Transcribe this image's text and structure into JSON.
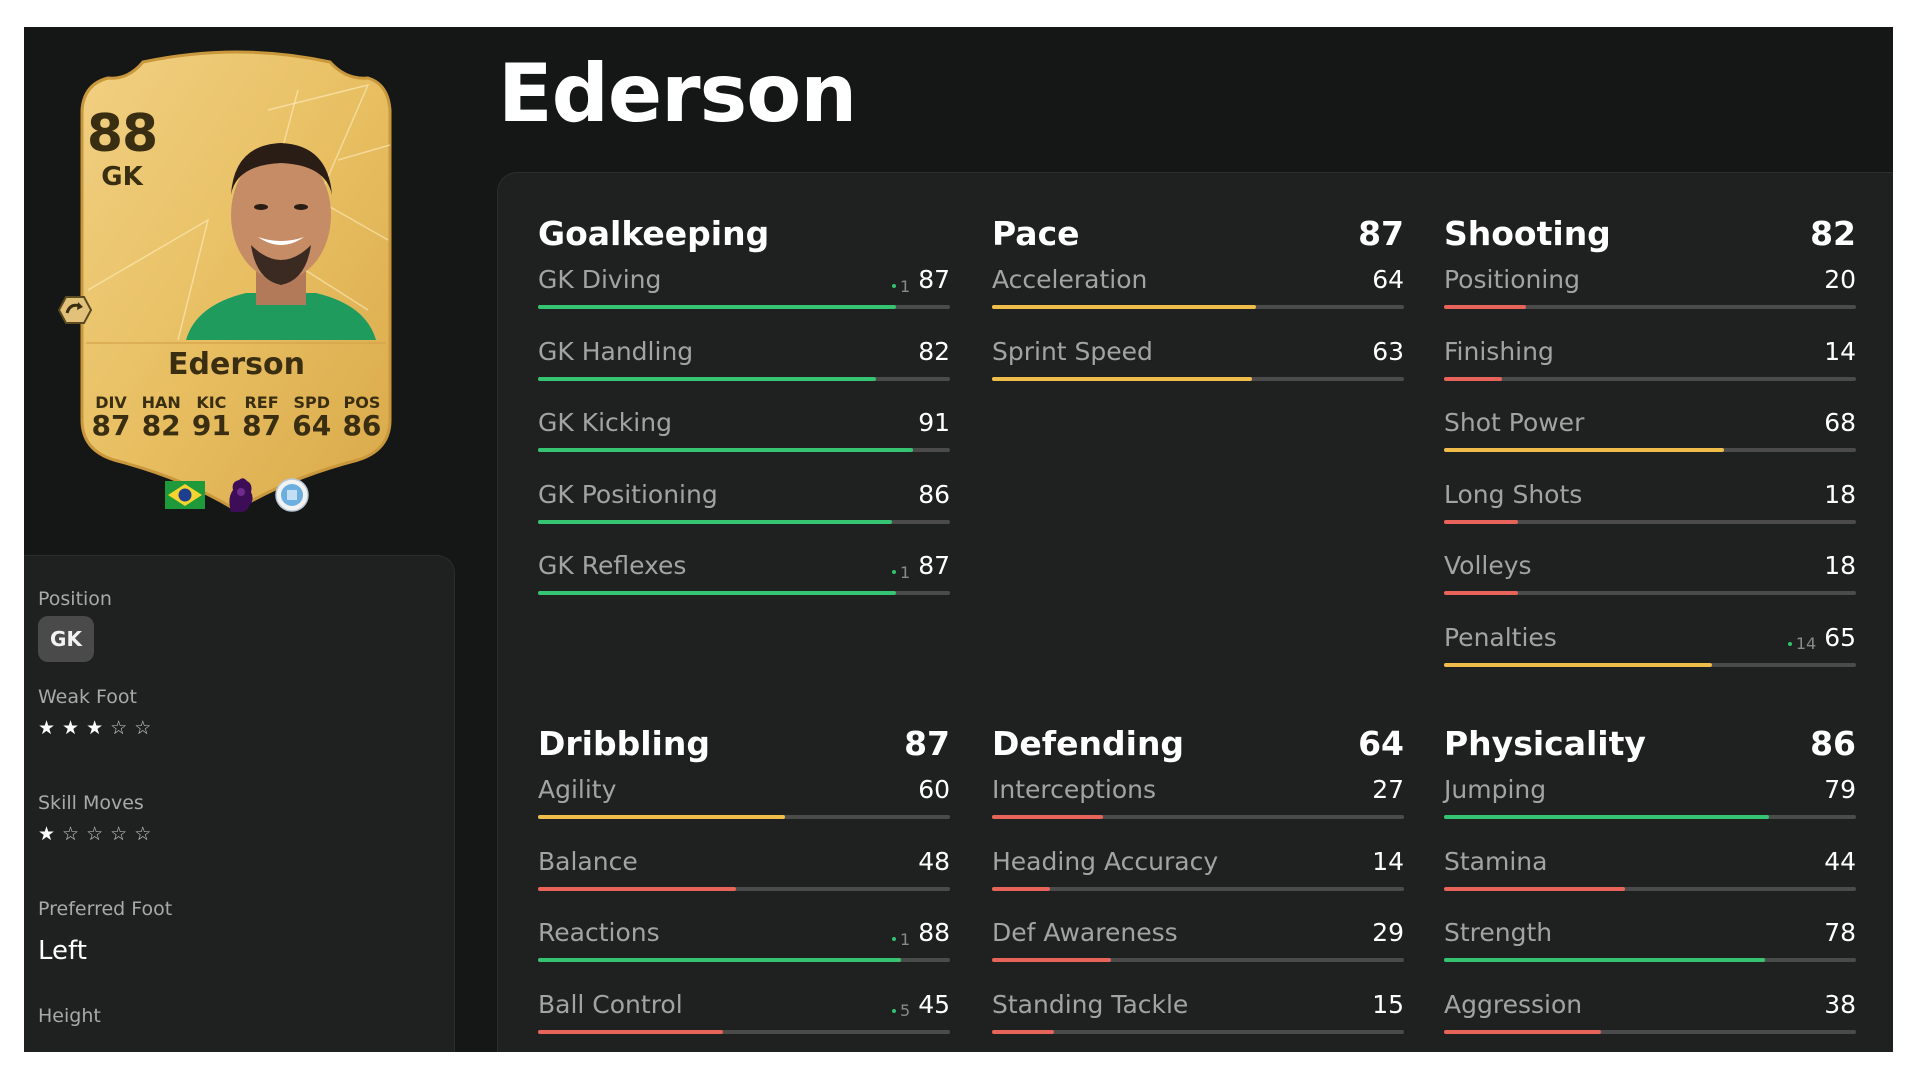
{
  "player": {
    "name": "Ederson",
    "overall": "88",
    "position": "GK",
    "card_stats": [
      {
        "key": "DIV",
        "value": "87"
      },
      {
        "key": "HAN",
        "value": "82"
      },
      {
        "key": "KIC",
        "value": "91"
      },
      {
        "key": "REF",
        "value": "87"
      },
      {
        "key": "SPD",
        "value": "64"
      },
      {
        "key": "POS",
        "value": "86"
      }
    ],
    "nation_icon": "brazil-flag-icon",
    "league_icon": "premier-league-icon",
    "club_icon": "manchester-city-crest-icon"
  },
  "info": {
    "position_label": "Position",
    "position_value": "GK",
    "weak_foot_label": "Weak Foot",
    "weak_foot_stars": 3,
    "skill_moves_label": "Skill Moves",
    "skill_moves_stars": 1,
    "max_stars": 5,
    "preferred_foot_label": "Preferred Foot",
    "preferred_foot_value": "Left",
    "height_label": "Height"
  },
  "colors": {
    "high": "#35c472",
    "mid": "#f0bd4b",
    "low": "#e8645a",
    "track": "#4b4b4b"
  },
  "sections": [
    {
      "title": "Goalkeeping",
      "value": "",
      "stats": [
        {
          "name": "GK Diving",
          "value": 87,
          "boost": "1"
        },
        {
          "name": "GK Handling",
          "value": 82,
          "boost": ""
        },
        {
          "name": "GK Kicking",
          "value": 91,
          "boost": ""
        },
        {
          "name": "GK Positioning",
          "value": 86,
          "boost": ""
        },
        {
          "name": "GK Reflexes",
          "value": 87,
          "boost": "1"
        }
      ]
    },
    {
      "title": "Pace",
      "value": "87",
      "stats": [
        {
          "name": "Acceleration",
          "value": 64,
          "boost": ""
        },
        {
          "name": "Sprint Speed",
          "value": 63,
          "boost": ""
        }
      ]
    },
    {
      "title": "Shooting",
      "value": "82",
      "stats": [
        {
          "name": "Positioning",
          "value": 20,
          "boost": ""
        },
        {
          "name": "Finishing",
          "value": 14,
          "boost": ""
        },
        {
          "name": "Shot Power",
          "value": 68,
          "boost": ""
        },
        {
          "name": "Long Shots",
          "value": 18,
          "boost": ""
        },
        {
          "name": "Volleys",
          "value": 18,
          "boost": ""
        },
        {
          "name": "Penalties",
          "value": 65,
          "boost": "14"
        }
      ]
    },
    {
      "title": "Dribbling",
      "value": "87",
      "stats": [
        {
          "name": "Agility",
          "value": 60,
          "boost": ""
        },
        {
          "name": "Balance",
          "value": 48,
          "boost": ""
        },
        {
          "name": "Reactions",
          "value": 88,
          "boost": "1"
        },
        {
          "name": "Ball Control",
          "value": 45,
          "boost": "5"
        }
      ]
    },
    {
      "title": "Defending",
      "value": "64",
      "stats": [
        {
          "name": "Interceptions",
          "value": 27,
          "boost": ""
        },
        {
          "name": "Heading Accuracy",
          "value": 14,
          "boost": ""
        },
        {
          "name": "Def Awareness",
          "value": 29,
          "boost": ""
        },
        {
          "name": "Standing Tackle",
          "value": 15,
          "boost": ""
        }
      ]
    },
    {
      "title": "Physicality",
      "value": "86",
      "stats": [
        {
          "name": "Jumping",
          "value": 79,
          "boost": ""
        },
        {
          "name": "Stamina",
          "value": 44,
          "boost": ""
        },
        {
          "name": "Strength",
          "value": 78,
          "boost": ""
        },
        {
          "name": "Aggression",
          "value": 38,
          "boost": ""
        }
      ]
    }
  ]
}
